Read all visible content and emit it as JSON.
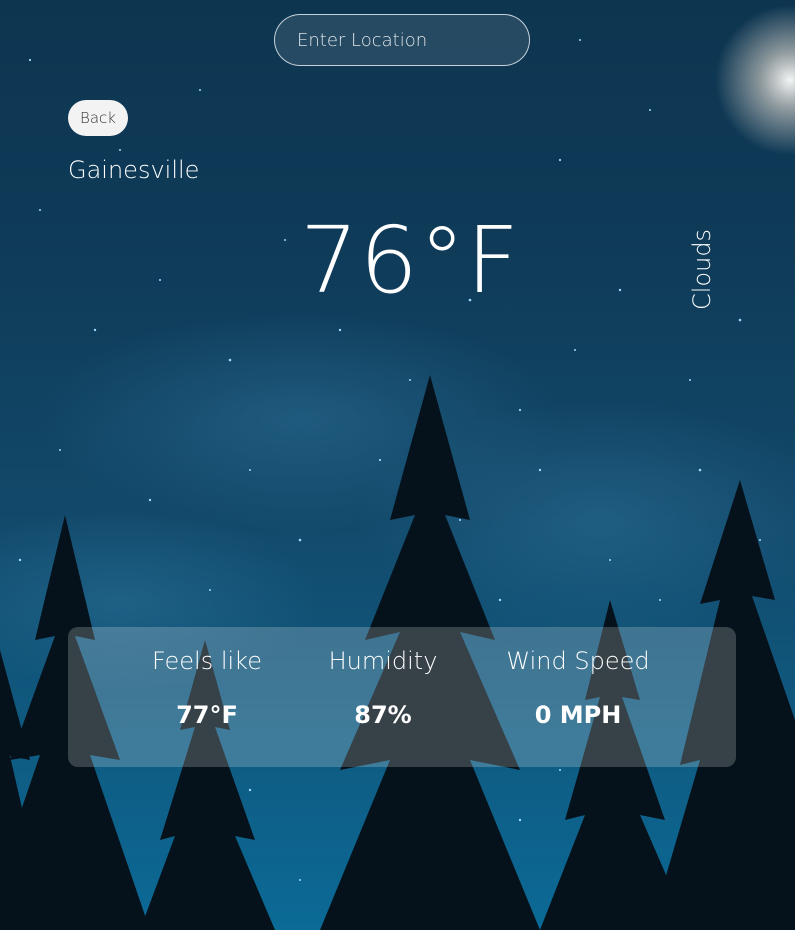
{
  "search": {
    "placeholder": "Enter Location",
    "value": ""
  },
  "back_button": {
    "label": "Back"
  },
  "location": {
    "city": "Gainesville"
  },
  "current": {
    "temperature": "76°F",
    "condition": "Clouds"
  },
  "stats": {
    "feels_like": {
      "label": "Feels like",
      "value": "77°F"
    },
    "humidity": {
      "label": "Humidity",
      "value": "87%"
    },
    "wind_speed": {
      "label": "Wind Speed",
      "value": "0 MPH"
    }
  },
  "colors": {
    "sky_top": "#0d3550",
    "sky_bottom": "#0b6a96",
    "text": "#ffffff",
    "tree_silhouette": "#06121b"
  }
}
